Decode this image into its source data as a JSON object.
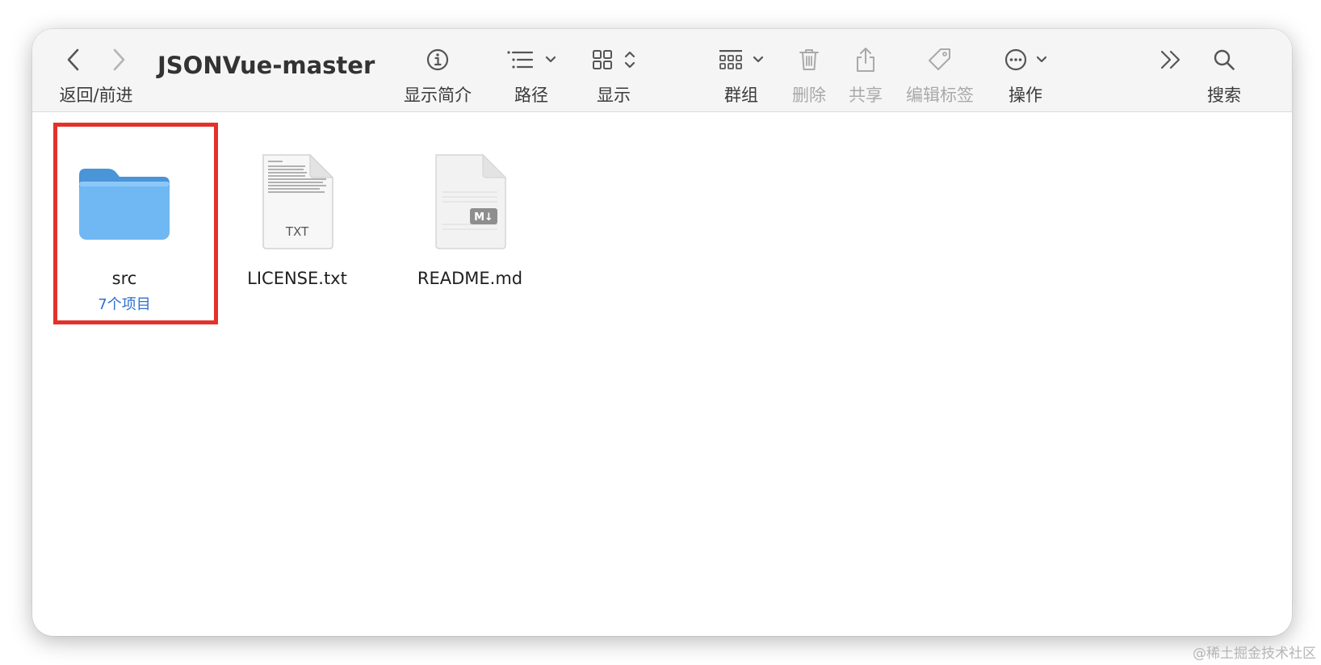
{
  "window": {
    "title": "JSONVue-master"
  },
  "toolbar": {
    "nav_label": "返回/前进",
    "info_label": "显示简介",
    "path_label": "路径",
    "view_label": "显示",
    "group_label": "群组",
    "delete_label": "删除",
    "share_label": "共享",
    "tags_label": "编辑标签",
    "action_label": "操作",
    "search_label": "搜索"
  },
  "files": [
    {
      "name": "src",
      "subtitle": "7个项目",
      "icon": "folder-icon"
    },
    {
      "name": "LICENSE.txt",
      "badge": "TXT",
      "icon": "text-file-icon"
    },
    {
      "name": "README.md",
      "badge": "M↓",
      "icon": "markdown-file-icon"
    }
  ],
  "watermark": "@稀土掘金技术社区",
  "colors": {
    "highlight": "#e3322b",
    "folder": "#6fb8f3",
    "subtitle": "#2f6fd0",
    "toolbar_bg": "#f5f5f5"
  }
}
